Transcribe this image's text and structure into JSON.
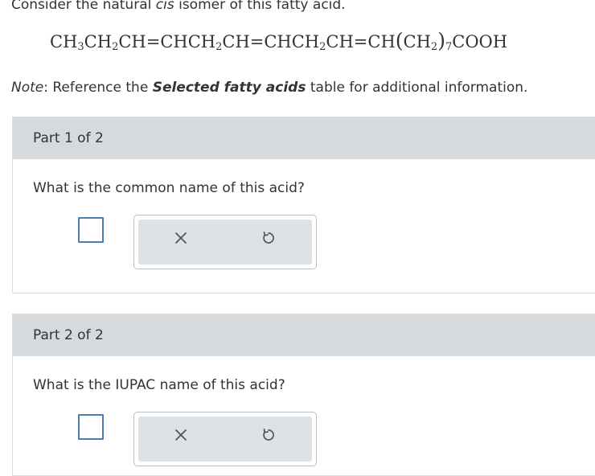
{
  "intro": {
    "before": "Consider the natural ",
    "italic": "cis",
    "after": " isomer of this fatty acid."
  },
  "formula": {
    "t1": "CH",
    "s1": "3",
    "t2": "CH",
    "s2": "2",
    "t3": "CH=CHCH",
    "s3": "2",
    "t4": "CH=CHCH",
    "s4": "2",
    "t5": "CH=CH",
    "lp": "(",
    "t6": "CH",
    "s6": "2",
    "rp": ")",
    "s7": "7",
    "t7": "COOH"
  },
  "note": {
    "label": "Note",
    "text1": ": Reference the ",
    "bold": "Selected fatty acids",
    "text2": " table for additional information."
  },
  "parts": [
    {
      "title": "Part 1 of 2",
      "question": "What is the common name of this acid?",
      "clear_icon": "close-x-icon",
      "reset_icon": "undo-circular-arrow-icon"
    },
    {
      "title": "Part 2 of 2",
      "question": "What is the IUPAC name of this acid?",
      "clear_icon": "close-x-icon",
      "reset_icon": "undo-circular-arrow-icon"
    }
  ],
  "colors": {
    "header_bg": "#d6dadd",
    "answer_border": "#4a7fb0",
    "tool_bg": "#dde2e6"
  }
}
